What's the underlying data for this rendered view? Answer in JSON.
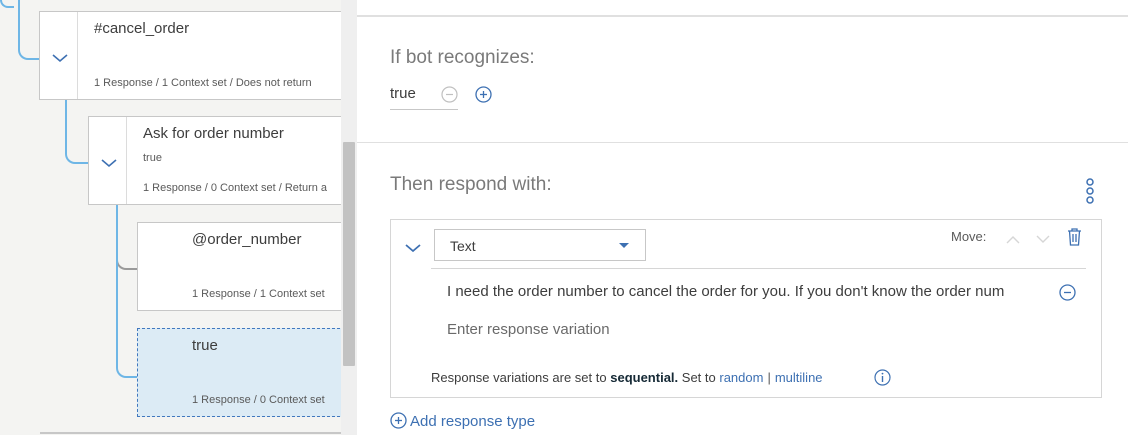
{
  "tree": {
    "nodes": [
      {
        "title": "#cancel_order",
        "condition": "",
        "meta": "1 Response / 1 Context set / Does not return"
      },
      {
        "title": "Ask for order number",
        "condition": "true",
        "meta": "1 Response / 0 Context set / Return a"
      },
      {
        "title": "@order_number",
        "condition": "",
        "meta": "1 Response / 1 Context set"
      },
      {
        "title": "true",
        "condition": "",
        "meta": "1 Response / 0 Context set"
      }
    ]
  },
  "editor": {
    "recognizes_heading": "If bot recognizes:",
    "condition_value": "true",
    "respond_heading": "Then respond with:",
    "response": {
      "type": "Text",
      "move_label": "Move:",
      "variations": [
        "I need the order number to cancel the order for you. If you don't know the order num"
      ],
      "variation_placeholder": "Enter response variation",
      "settings_prefix": "Response variations are set to",
      "settings_mode": "sequential.",
      "settings_set_to": "Set to",
      "link_random": "random",
      "link_separator": "|",
      "link_multiline": "multiline"
    },
    "add_response_label": "Add response type"
  },
  "colors": {
    "accent": "#3d70b2",
    "tree_line": "#6eb6e6",
    "selected_node_bg": "#dcebf5"
  },
  "icons": {
    "expander": "chevron-down-icon",
    "remove": "minus-circle-icon",
    "add": "plus-circle-icon",
    "menu": "kebab-menu-icon",
    "delete": "trash-icon",
    "info": "info-icon"
  }
}
